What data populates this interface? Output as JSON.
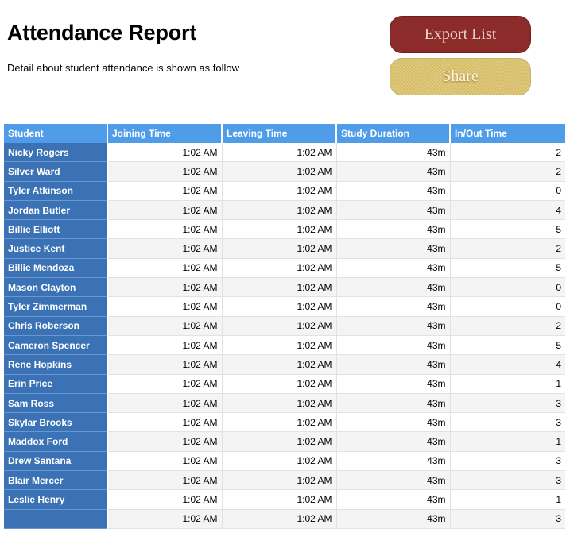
{
  "header": {
    "title": "Attendance Report",
    "subtitle": "Detail about student attendance is shown as follow"
  },
  "actions": {
    "export_label": "Export List",
    "share_label": "Share"
  },
  "colors": {
    "export_button": "#8b2b2a",
    "share_button": "#dcc36f",
    "header_row": "#4f9de8",
    "name_column": "#3a72b5"
  },
  "table": {
    "columns": [
      "Student",
      "Joining Time",
      "Leaving Time",
      "Study Duration",
      "In/Out Time"
    ],
    "rows": [
      [
        "Nicky Rogers",
        "1:02 AM",
        "1:02 AM",
        "43m",
        "2"
      ],
      [
        "Silver Ward",
        "1:02 AM",
        "1:02 AM",
        "43m",
        "2"
      ],
      [
        "Tyler Atkinson",
        "1:02 AM",
        "1:02 AM",
        "43m",
        "0"
      ],
      [
        "Jordan Butler",
        "1:02 AM",
        "1:02 AM",
        "43m",
        "4"
      ],
      [
        "Billie Elliott",
        "1:02 AM",
        "1:02 AM",
        "43m",
        "5"
      ],
      [
        "Justice Kent",
        "1:02 AM",
        "1:02 AM",
        "43m",
        "2"
      ],
      [
        "Billie Mendoza",
        "1:02 AM",
        "1:02 AM",
        "43m",
        "5"
      ],
      [
        "Mason Clayton",
        "1:02 AM",
        "1:02 AM",
        "43m",
        "0"
      ],
      [
        "Tyler Zimmerman",
        "1:02 AM",
        "1:02 AM",
        "43m",
        "0"
      ],
      [
        "Chris Roberson",
        "1:02 AM",
        "1:02 AM",
        "43m",
        "2"
      ],
      [
        "Cameron Spencer",
        "1:02 AM",
        "1:02 AM",
        "43m",
        "5"
      ],
      [
        "Rene Hopkins",
        "1:02 AM",
        "1:02 AM",
        "43m",
        "4"
      ],
      [
        "Erin Price",
        "1:02 AM",
        "1:02 AM",
        "43m",
        "1"
      ],
      [
        "Sam Ross",
        "1:02 AM",
        "1:02 AM",
        "43m",
        "3"
      ],
      [
        "Skylar Brooks",
        "1:02 AM",
        "1:02 AM",
        "43m",
        "3"
      ],
      [
        "Maddox Ford",
        "1:02 AM",
        "1:02 AM",
        "43m",
        "1"
      ],
      [
        "Drew Santana",
        "1:02 AM",
        "1:02 AM",
        "43m",
        "3"
      ],
      [
        "Blair Mercer",
        "1:02 AM",
        "1:02 AM",
        "43m",
        "3"
      ],
      [
        "Leslie Henry",
        "1:02 AM",
        "1:02 AM",
        "43m",
        "1"
      ],
      [
        "",
        "1:02 AM",
        "1:02 AM",
        "43m",
        "3"
      ]
    ]
  }
}
